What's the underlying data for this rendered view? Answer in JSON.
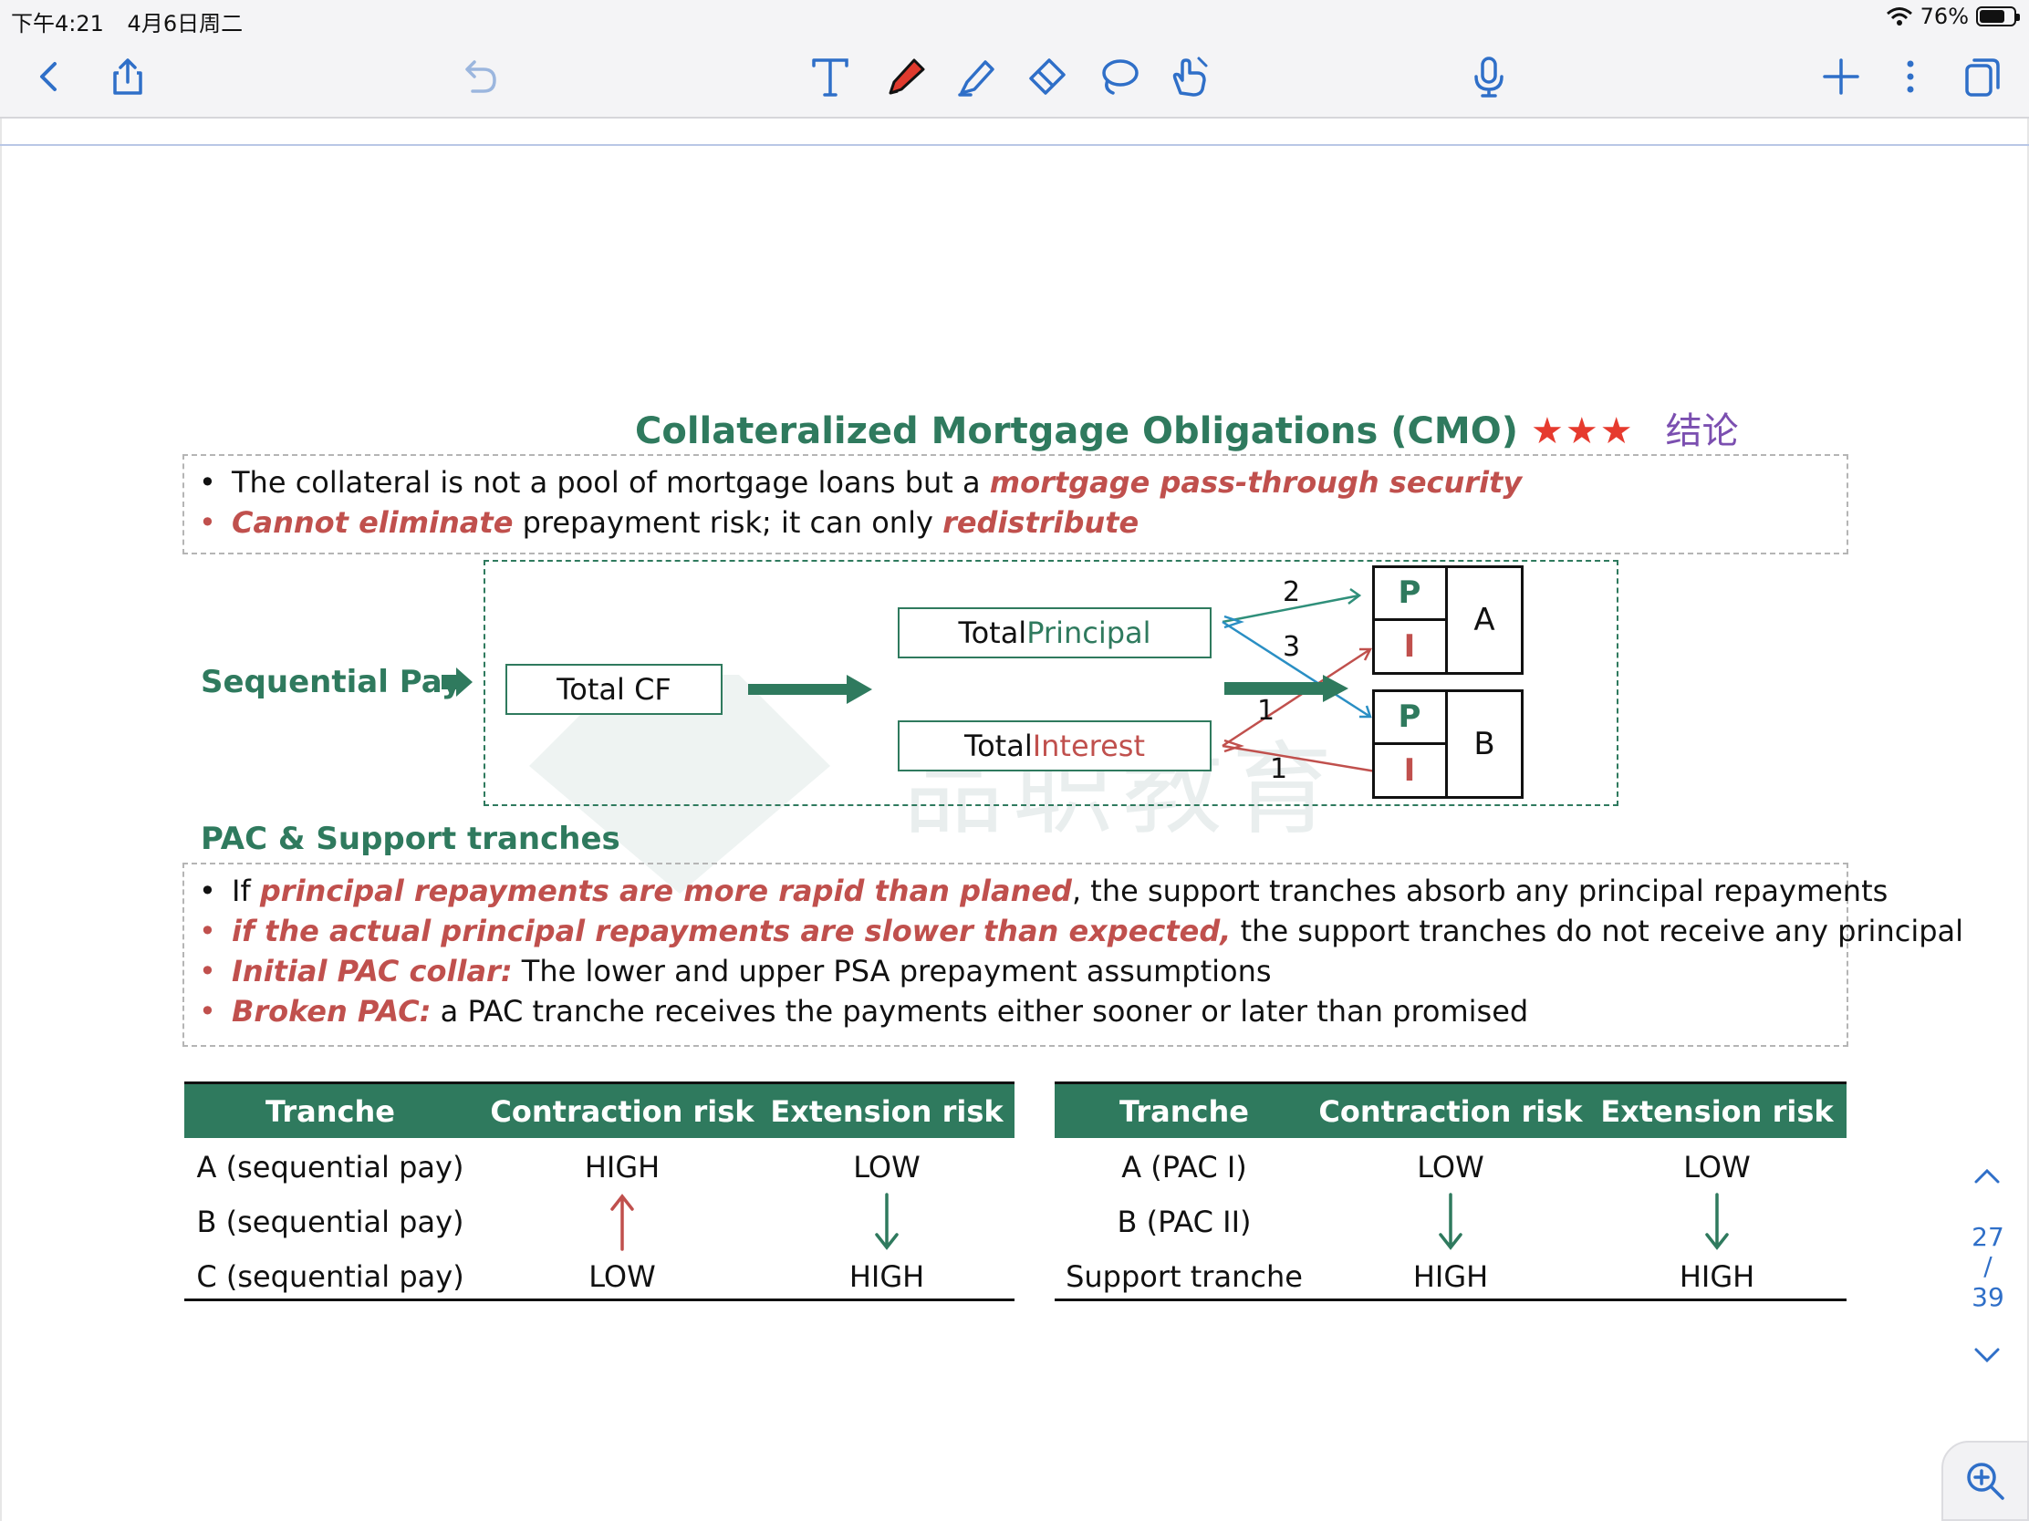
{
  "status_bar": {
    "time": "下午4:21",
    "date": "4月6日周二",
    "battery": "76%",
    "battery_level": 0.76
  },
  "toolbar": {
    "left_icons": [
      "back-chevron-icon",
      "share-icon",
      "undo-icon"
    ],
    "center_tools": [
      "text-tool-icon",
      "pen-tool-icon",
      "highlighter-tool-icon",
      "eraser-tool-icon",
      "lasso-tool-icon",
      "hand-tool-icon"
    ],
    "mic_icon": "microphone-icon",
    "right_icons": [
      "add-icon",
      "more-icon",
      "pages-icon"
    ],
    "accent": "#2f6fc8",
    "pen_color": "#e03a2e"
  },
  "slide": {
    "title": "Collateralized Mortgage Obligations (CMO)",
    "stars": "★★★",
    "title_cn": "结论",
    "intro_bullets": [
      {
        "text_before": "The collateral is not a pool of mortgage loans but a ",
        "emph": "mortgage pass-through security",
        "text_after": ""
      },
      {
        "emph": "Cannot eliminate",
        "text_mid": " prepayment risk; it can only ",
        "emph2": "redistribute"
      }
    ],
    "diagram": {
      "label": "Sequential Pay",
      "total_cf": "Total CF",
      "total_principal": {
        "word1": "Total ",
        "word2": "Principal"
      },
      "total_interest": {
        "word1": "Total ",
        "word2": "Interest"
      },
      "numbers": [
        "2",
        "3",
        "1",
        "1"
      ],
      "tranche_a": {
        "p": "P",
        "i": "I",
        "name": "A"
      },
      "tranche_b": {
        "p": "P",
        "i": "I",
        "name": "B"
      },
      "watermark": "品职教育"
    },
    "pac_section": {
      "heading": "PAC & Support tranches",
      "bullets": [
        {
          "pre": "If ",
          "emph": "principal repayments are more rapid than planed",
          "post": ", the support tranches absorb any principal repayments"
        },
        {
          "pre": "",
          "emph": "if the actual principal repayments are slower than expected,",
          "post": " the support tranches do not receive any principal"
        },
        {
          "pre": "",
          "emph": "Initial PAC collar:",
          "post": " The lower and upper PSA prepayment assumptions"
        },
        {
          "pre": "",
          "emph": "Broken PAC:",
          "post": " a PAC tranche receives the payments either sooner or later than promised"
        }
      ]
    },
    "table_left": {
      "headers": [
        "Tranche",
        "Contraction risk",
        "Extension risk"
      ],
      "rows": [
        [
          "A (sequential pay)",
          "HIGH",
          "LOW"
        ],
        [
          "B (sequential pay)",
          "",
          ""
        ],
        [
          "C (sequential pay)",
          "LOW",
          "HIGH"
        ]
      ]
    },
    "table_right": {
      "headers": [
        "Tranche",
        "Contraction risk",
        "Extension risk"
      ],
      "rows": [
        [
          "A (PAC I)",
          "LOW",
          "LOW"
        ],
        [
          "B (PAC II)",
          "",
          ""
        ],
        [
          "Support tranche",
          "HIGH",
          "HIGH"
        ]
      ]
    }
  },
  "page_nav": {
    "current": "27",
    "separator": "/",
    "total": "39"
  }
}
